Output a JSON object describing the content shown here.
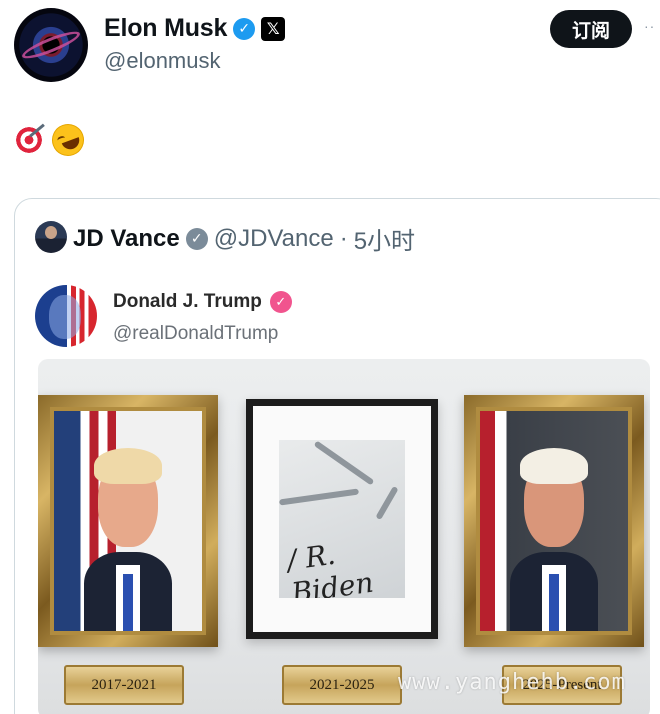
{
  "author": {
    "name": "Elon Musk",
    "handle": "@elonmusk",
    "verified_icon": "verified-check-icon",
    "affiliation_icon": "x-logo-icon"
  },
  "actions": {
    "subscribe_label": "订阅",
    "more_label": "··"
  },
  "tweet": {
    "emojis": [
      "direct-hit-emoji",
      "rolling-on-floor-laughing-emoji"
    ]
  },
  "quoted": {
    "name": "JD Vance",
    "handle": "@JDVance",
    "separator": "·",
    "time": "5小时",
    "verified_color": "#7b8b99"
  },
  "nested": {
    "name": "Donald J. Trump",
    "handle": "@realDonaldTrump",
    "verified_color": "#f1548e"
  },
  "media": {
    "plaques": [
      "2017-2021",
      "2021-2025",
      "2025-Present"
    ],
    "signature": "/ R. Biden"
  },
  "watermark": "www.yanghehb.com",
  "colors": {
    "accent_blue": "#1d9bf0",
    "text_primary": "#0f1419",
    "text_secondary": "#536471",
    "gold": "#c6a45b"
  }
}
